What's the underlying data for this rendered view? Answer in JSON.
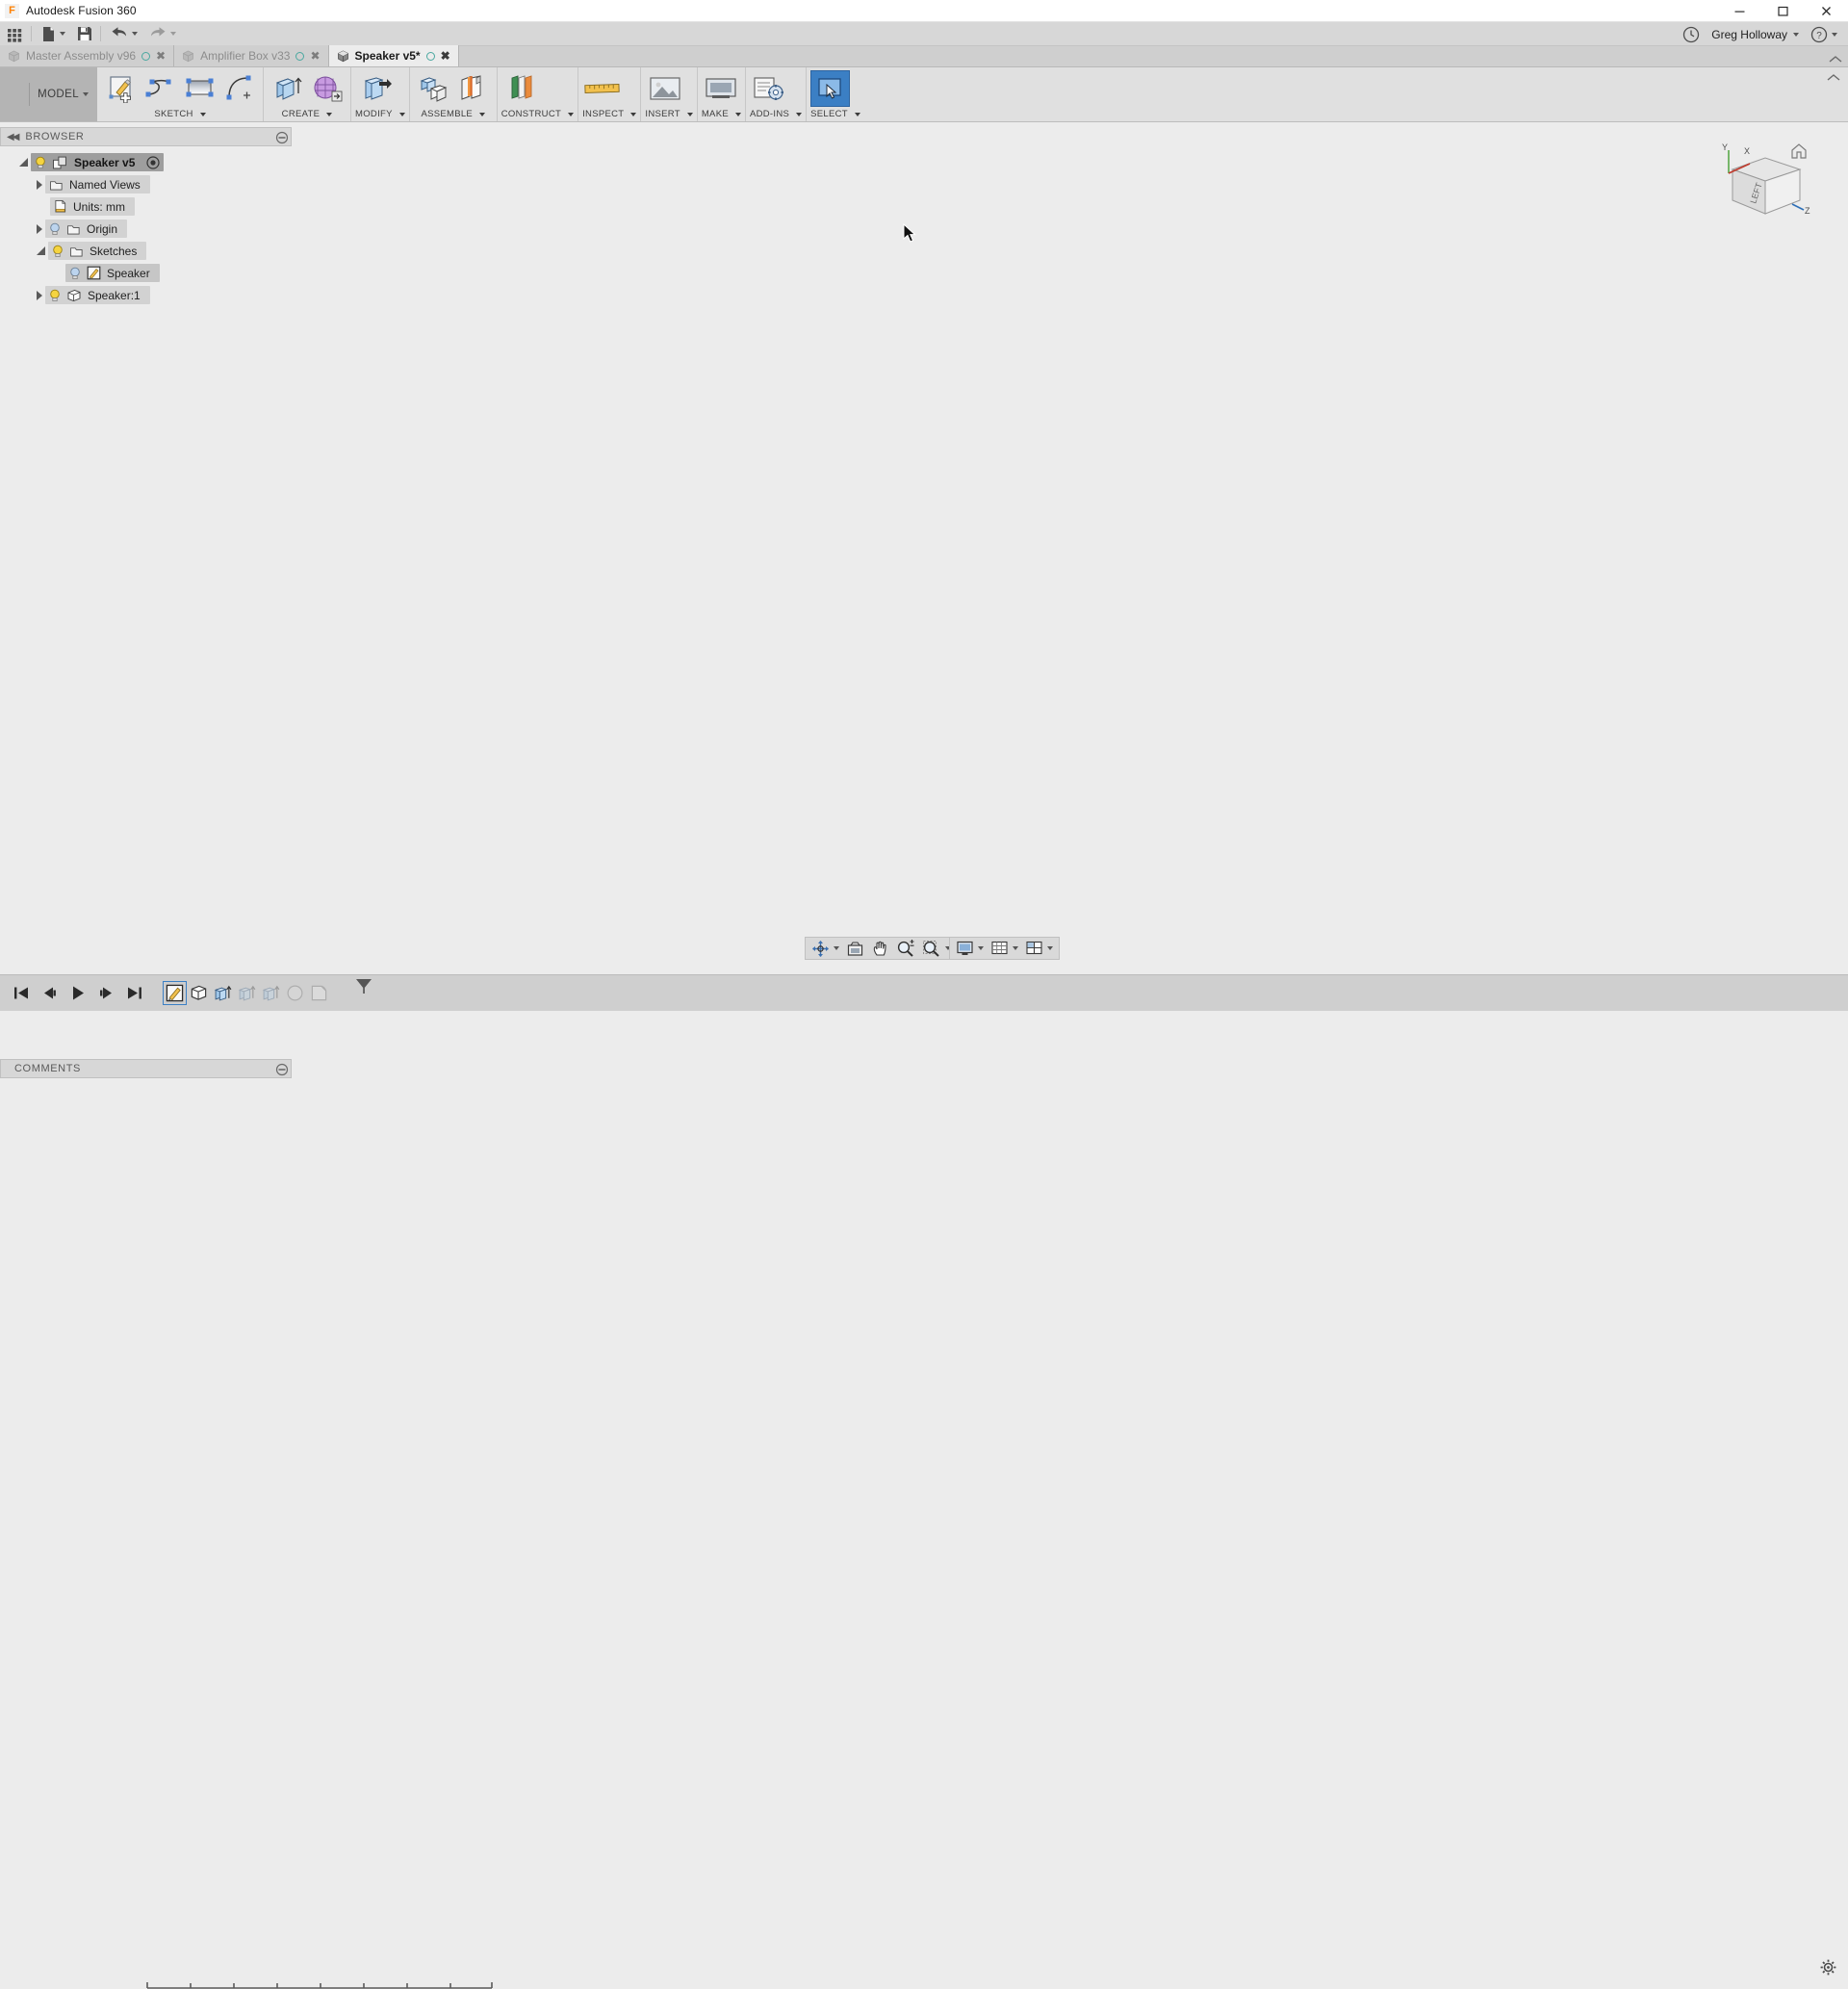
{
  "window": {
    "app_title": "Autodesk Fusion 360",
    "logo_text": "F",
    "controls": {
      "minimize": "minimize-icon",
      "maximize": "maximize-icon",
      "close": "close-icon"
    }
  },
  "quick_access": {
    "items": [
      {
        "name": "app-grid-button",
        "icon": "grid-icon",
        "has_caret": false
      },
      {
        "name": "new-document-button",
        "icon": "file-icon",
        "has_caret": true
      },
      {
        "name": "save-button",
        "icon": "save-icon",
        "has_caret": false
      },
      {
        "name": "undo-button",
        "icon": "undo-arrow-icon",
        "has_caret": true
      },
      {
        "name": "redo-button",
        "icon": "redo-arrow-icon",
        "has_caret": true
      }
    ],
    "user_name": "Greg Holloway",
    "help_label": "?",
    "recent_icon": "clock-icon"
  },
  "tabs": [
    {
      "label": "Master Assembly v96",
      "active": false,
      "modified": false,
      "dot": "save-status-dot",
      "close": "✖"
    },
    {
      "label": "Amplifier Box v33",
      "active": false,
      "modified": false,
      "dot": "save-status-dot",
      "close": "✖"
    },
    {
      "label": "Speaker v5*",
      "active": true,
      "modified": true,
      "dot": "save-status-dot",
      "close": "✖"
    }
  ],
  "ribbon": {
    "workspace": {
      "label": "MODEL",
      "caret": true
    },
    "groups": [
      {
        "label": "SKETCH",
        "caret": true,
        "buttons": [
          {
            "name": "create-sketch-button",
            "icon": "sketch-create-icon"
          },
          {
            "name": "spline-button",
            "icon": "spline-icon"
          },
          {
            "name": "rectangle-button",
            "icon": "rectangle-icon"
          },
          {
            "name": "arc-button",
            "icon": "arc-icon"
          }
        ]
      },
      {
        "label": "CREATE",
        "caret": true,
        "buttons": [
          {
            "name": "extrude-button",
            "icon": "extrude-icon"
          },
          {
            "name": "create-form-button",
            "icon": "form-mesh-icon"
          }
        ]
      },
      {
        "label": "MODIFY",
        "caret": true,
        "buttons": [
          {
            "name": "press-pull-button",
            "icon": "press-pull-icon"
          }
        ]
      },
      {
        "label": "ASSEMBLE",
        "caret": true,
        "buttons": [
          {
            "name": "new-component-button",
            "icon": "new-component-icon"
          },
          {
            "name": "joint-button",
            "icon": "joint-icon"
          }
        ]
      },
      {
        "label": "CONSTRUCT",
        "caret": true,
        "buttons": [
          {
            "name": "offset-plane-button",
            "icon": "offset-plane-icon"
          }
        ]
      },
      {
        "label": "INSPECT",
        "caret": true,
        "buttons": [
          {
            "name": "measure-button",
            "icon": "ruler-icon"
          }
        ]
      },
      {
        "label": "INSERT",
        "caret": true,
        "buttons": [
          {
            "name": "insert-mcmaster-button",
            "icon": "insert-image-icon"
          }
        ]
      },
      {
        "label": "MAKE",
        "caret": true,
        "buttons": [
          {
            "name": "3d-print-button",
            "icon": "3d-print-icon"
          }
        ]
      },
      {
        "label": "ADD-INS",
        "caret": true,
        "buttons": [
          {
            "name": "scripts-addins-button",
            "icon": "gear-script-icon"
          }
        ]
      },
      {
        "label": "SELECT",
        "caret": true,
        "buttons": [
          {
            "name": "select-tool-button",
            "icon": "select-window-icon",
            "selected": true
          }
        ]
      }
    ]
  },
  "browser": {
    "header": "BROWSER",
    "collapse_icon": "collapse-arrows-icon",
    "panel_icon": "panel-dot-icon",
    "tree": [
      {
        "label": "Speaker v5",
        "depth": 0,
        "expander": "open",
        "bulb": "on",
        "icon": "component-icon",
        "root": true,
        "extra_icon": "document-settings-icon"
      },
      {
        "label": "Named Views",
        "depth": 1,
        "expander": "closed",
        "bulb": "none",
        "icon": "folder-icon"
      },
      {
        "label": "Units: mm",
        "depth": 2,
        "expander": "none",
        "bulb": "none",
        "icon": "units-doc-icon"
      },
      {
        "label": "Origin",
        "depth": 1,
        "expander": "closed",
        "bulb": "off",
        "icon": "folder-icon"
      },
      {
        "label": "Sketches",
        "depth": 1,
        "expander": "open",
        "bulb": "on",
        "icon": "folder-icon"
      },
      {
        "label": "Speaker",
        "depth": 2,
        "expander": "none",
        "bulb": "off",
        "icon": "sketch-icon"
      },
      {
        "label": "Speaker:1",
        "depth": 1,
        "expander": "closed",
        "bulb": "on",
        "icon": "body-icon"
      }
    ]
  },
  "comments": {
    "label": "COMMENTS",
    "panel_icon": "panel-dot-icon"
  },
  "view_cube": {
    "front_face_label": "LEFT",
    "axis_x": "X",
    "axis_y": "Y",
    "axis_z": "Z",
    "home_icon": "home-icon"
  },
  "navigation_bar": {
    "buttons": [
      {
        "name": "orbit-button",
        "icon": "orbit-icon",
        "caret": true
      },
      {
        "name": "look-at-button",
        "icon": "look-at-icon",
        "caret": false
      },
      {
        "name": "pan-button",
        "icon": "pan-hand-icon",
        "caret": false
      },
      {
        "name": "zoom-button",
        "icon": "zoom-magnifier-icon",
        "caret": false
      },
      {
        "name": "fit-button",
        "icon": "zoom-fit-icon",
        "caret": true
      }
    ],
    "display_buttons": [
      {
        "name": "display-settings-button",
        "icon": "display-monitor-icon",
        "caret": true
      },
      {
        "name": "grid-snaps-button",
        "icon": "grid-icon",
        "caret": true
      },
      {
        "name": "viewports-button",
        "icon": "viewports-icon",
        "caret": true
      }
    ]
  },
  "timeline": {
    "playback": [
      {
        "name": "timeline-begin-button",
        "icon": "skip-to-start-icon"
      },
      {
        "name": "timeline-step-back-button",
        "icon": "step-back-icon"
      },
      {
        "name": "timeline-play-button",
        "icon": "play-icon"
      },
      {
        "name": "timeline-step-forward-button",
        "icon": "step-forward-icon"
      },
      {
        "name": "timeline-end-button",
        "icon": "skip-to-end-icon"
      }
    ],
    "features": [
      {
        "name": "timeline-feature-sketch",
        "icon": "sketch-icon",
        "state": "selected"
      },
      {
        "name": "timeline-feature-body",
        "icon": "body-icon",
        "state": "normal"
      },
      {
        "name": "timeline-feature-extrude",
        "icon": "extrude-icon",
        "state": "normal"
      },
      {
        "name": "timeline-feature-extrude-2",
        "icon": "extrude-icon",
        "state": "ghost"
      },
      {
        "name": "timeline-feature-extrude-3",
        "icon": "extrude-icon",
        "state": "ghost"
      },
      {
        "name": "timeline-feature-fillet",
        "icon": "fillet-icon",
        "state": "ghost"
      },
      {
        "name": "timeline-feature-shell",
        "icon": "shell-icon",
        "state": "ghost"
      }
    ],
    "marker_name": "timeline-playhead-marker",
    "settings_icon": "gear-icon"
  },
  "canvas": {
    "model_name": "speaker-baffle-body",
    "model_fill": "#c9c5b4",
    "model_edge": "#6e6e6e",
    "background": "#ececec",
    "sketch_line": "#b9b9b9"
  }
}
